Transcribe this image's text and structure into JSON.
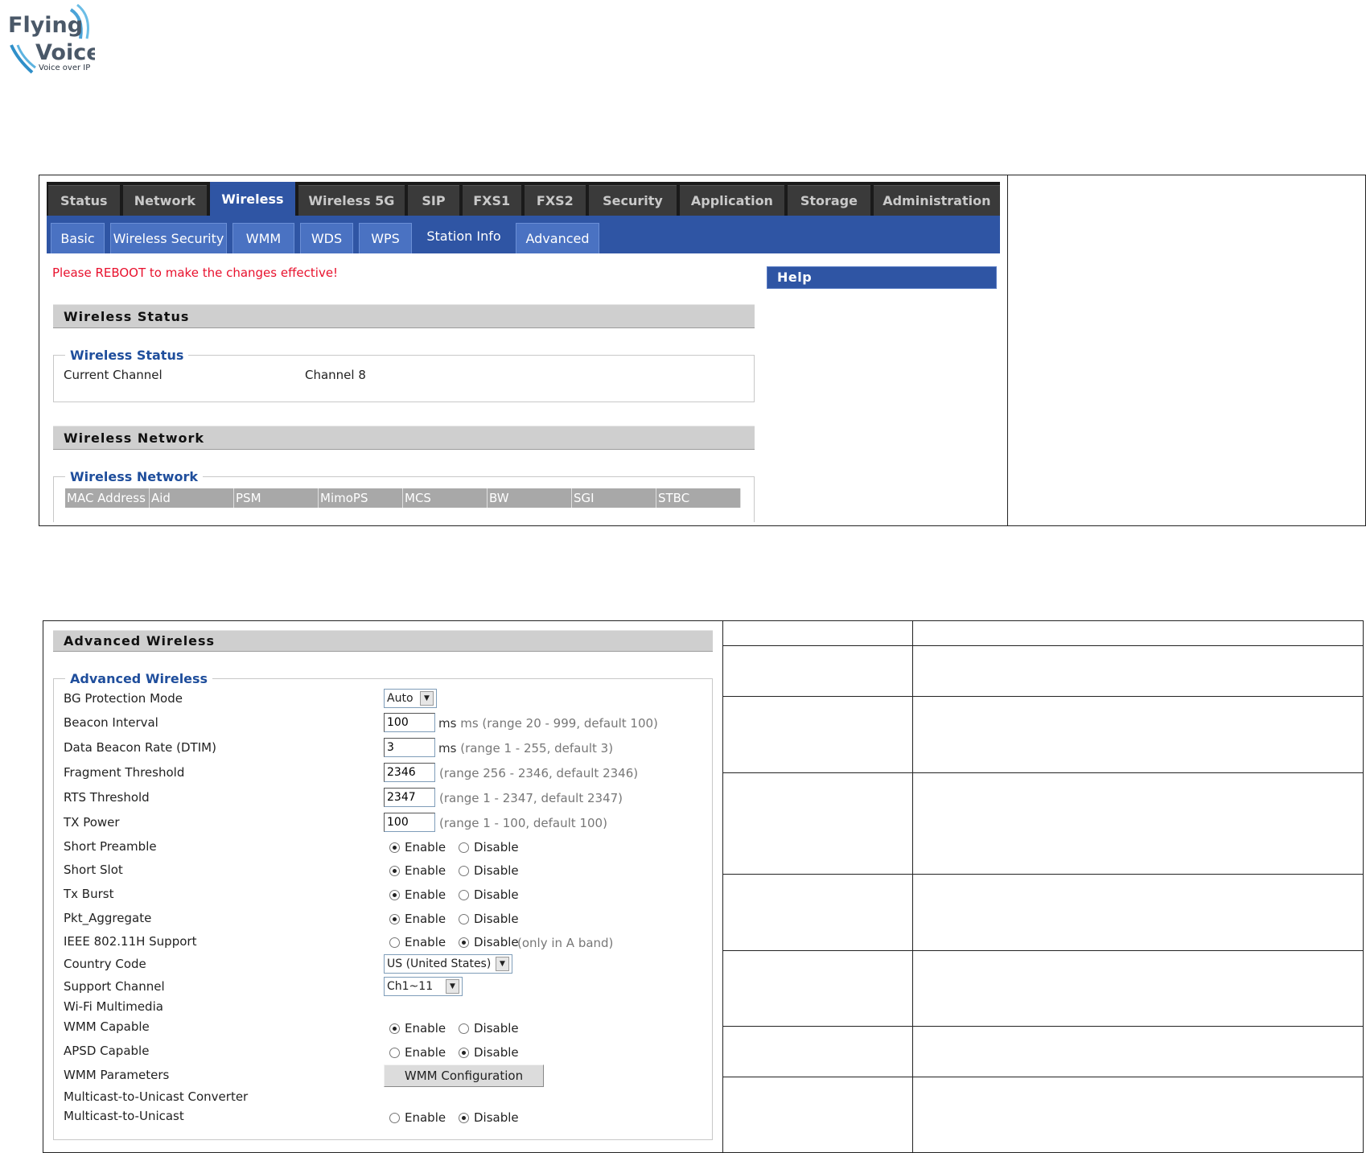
{
  "logo": {
    "line1": "Flying",
    "line2": "Voice",
    "tagline": "Voice over IP"
  },
  "main_tabs": [
    "Status",
    "Network",
    "Wireless",
    "Wireless 5G",
    "SIP",
    "FXS1",
    "FXS2",
    "Security",
    "Application",
    "Storage",
    "Administration"
  ],
  "main_tabs_active": "Wireless",
  "sub_tabs": [
    "Basic",
    "Wireless Security",
    "WMM",
    "WDS",
    "WPS",
    "Station Info",
    "Advanced"
  ],
  "sub_tabs_active": "Station Info",
  "reboot_message": "Please REBOOT to make the changes effective!",
  "help_title": "Help",
  "wireless_status": {
    "section_title": "Wireless Status",
    "legend": "Wireless Status",
    "current_channel_label": "Current Channel",
    "current_channel_value": "Channel 8"
  },
  "wireless_network": {
    "section_title": "Wireless Network",
    "legend": "Wireless Network",
    "columns": [
      "MAC Address",
      "Aid",
      "PSM",
      "MimoPS",
      "MCS",
      "BW",
      "SGI",
      "STBC"
    ]
  },
  "advanced": {
    "section_title": "Advanced Wireless",
    "legend": "Advanced Wireless",
    "bg_protection": {
      "label": "BG Protection Mode",
      "value": "Auto"
    },
    "beacon_interval": {
      "label": "Beacon Interval",
      "value": "100",
      "unit": "ms",
      "hint": "ms (range 20 - 999, default 100)"
    },
    "dtim": {
      "label": "Data Beacon Rate (DTIM)",
      "value": "3",
      "unit": "ms",
      "hint": "(range 1 - 255, default 3)"
    },
    "fragment": {
      "label": "Fragment Threshold",
      "value": "2346",
      "hint": "(range 256 - 2346, default 2346)"
    },
    "rts": {
      "label": "RTS Threshold",
      "value": "2347",
      "hint": "(range 1 - 2347, default 2347)"
    },
    "tx_power": {
      "label": "TX Power",
      "value": "100",
      "hint": "(range 1 - 100, default 100)"
    },
    "enable_label": "Enable",
    "disable_label": "Disable",
    "short_preamble": {
      "label": "Short Preamble",
      "selected": "Enable"
    },
    "short_slot": {
      "label": "Short Slot",
      "selected": "Enable"
    },
    "tx_burst": {
      "label": "Tx Burst",
      "selected": "Enable"
    },
    "pkt_aggregate": {
      "label": "Pkt_Aggregate",
      "selected": "Enable"
    },
    "ieee_80211h": {
      "label": "IEEE 802.11H Support",
      "selected": "Disable",
      "hint": "(only in A band)"
    },
    "country_code": {
      "label": "Country Code",
      "value": "US (United States)"
    },
    "support_channel": {
      "label": "Support Channel",
      "value": "Ch1~11"
    },
    "wifi_multimedia_label": "Wi-Fi Multimedia",
    "wmm_capable": {
      "label": "WMM Capable",
      "selected": "Enable"
    },
    "apsd_capable": {
      "label": "APSD Capable",
      "selected": "Disable"
    },
    "wmm_parameters": {
      "label": "WMM Parameters",
      "button": "WMM Configuration"
    },
    "multicast_converter_label": "Multicast-to-Unicast Converter",
    "multicast_to_unicast": {
      "label": "Multicast-to-Unicast",
      "selected": "Disable"
    }
  }
}
